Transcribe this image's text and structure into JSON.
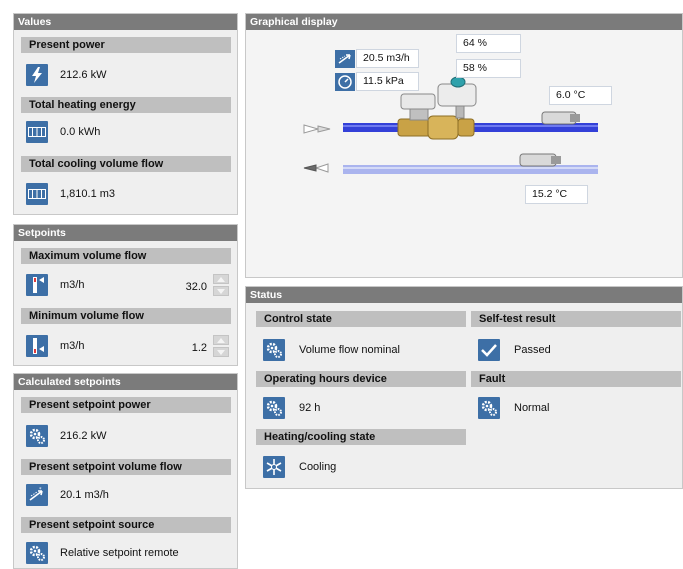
{
  "values": {
    "title": "Values",
    "present_power": {
      "label": "Present power",
      "value": "212.6 kW"
    },
    "total_heating": {
      "label": "Total heating energy",
      "value": "0.0 kWh"
    },
    "total_cooling": {
      "label": "Total cooling volume flow",
      "value": "1,810.1 m3"
    }
  },
  "setpoints": {
    "title": "Setpoints",
    "max_flow": {
      "label": "Maximum volume flow",
      "unit": "m3/h",
      "value": "32.0"
    },
    "min_flow": {
      "label": "Minimum volume flow",
      "unit": "m3/h",
      "value": "1.2"
    }
  },
  "calculated": {
    "title": "Calculated setpoints",
    "sp_power": {
      "label": "Present setpoint power",
      "value": "216.2 kW"
    },
    "sp_flow": {
      "label": "Present setpoint volume flow",
      "value": "20.1 m3/h"
    },
    "sp_source": {
      "label": "Present setpoint source",
      "value": "Relative setpoint remote"
    }
  },
  "graphical": {
    "title": "Graphical display",
    "flow": "20.5 m3/h",
    "pressure": "11.5 kPa",
    "valve1": "64 %",
    "valve2": "58 %",
    "temp_supply": "6.0 °C",
    "temp_return": "15.2 °C"
  },
  "status": {
    "title": "Status",
    "control_state": {
      "label": "Control state",
      "value": "Volume flow nominal"
    },
    "self_test": {
      "label": "Self-test result",
      "value": "Passed"
    },
    "op_hours": {
      "label": "Operating hours device",
      "value": "92 h"
    },
    "fault": {
      "label": "Fault",
      "value": "Normal"
    },
    "hc_state": {
      "label": "Heating/cooling state",
      "value": "Cooling"
    }
  },
  "colors": {
    "header": "#7b7b7b",
    "section": "#bfbfbf",
    "icon": "#3d6fa6",
    "pipe_supply": "#3340d8",
    "pipe_return": "#aab4ee"
  }
}
